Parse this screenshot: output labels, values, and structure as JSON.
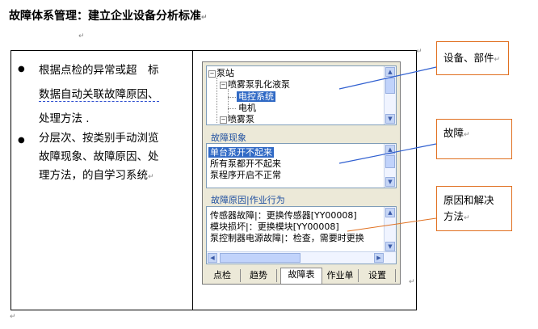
{
  "document": {
    "title": "故障体系管理：建立企业设备分析标准",
    "para_mark": "↵"
  },
  "left_column": {
    "bullets": [
      {
        "lines": [
          "根据点检的异常或超　标",
          "数据自动关联故障原因、",
          "处理方法 ."
        ]
      },
      {
        "lines": [
          "分层次、按类别手动浏览",
          "故障现象、故障原因、处",
          "理方法，的自学习系统"
        ]
      }
    ],
    "bullet_symbol": "●"
  },
  "app": {
    "tree": {
      "items": [
        {
          "label": "泵站",
          "expander": "−"
        },
        {
          "label": "喷雾泵乳化液泵",
          "expander": "−"
        },
        {
          "label": "电控系统",
          "selected": true
        },
        {
          "label": "电机"
        },
        {
          "label": "喷雾泵",
          "expander": "−"
        }
      ]
    },
    "symptoms": {
      "title": "故障现象",
      "items": [
        {
          "label": "单台泵开不起来",
          "selected": true
        },
        {
          "label": "所有泵都开不起来"
        },
        {
          "label": "泵程序开启不正常"
        }
      ]
    },
    "causes": {
      "title": "故障原因|作业行为",
      "items": [
        {
          "label": "传感器故障|：更换传感器[YY00008]"
        },
        {
          "label": "模块损坏|：更换模块[YY00008]"
        },
        {
          "label": "泵控制器电源故障|：检查，需要时更换"
        }
      ]
    },
    "tabs": [
      {
        "label": "点检"
      },
      {
        "label": "趋势"
      },
      {
        "label": "故障表",
        "active": true
      },
      {
        "label": "作业单"
      },
      {
        "label": "设置"
      }
    ]
  },
  "callouts": {
    "equipment": "设备、部件",
    "fault": "故障",
    "cause_line1": "原因和解决",
    "cause_line2": "方法"
  },
  "colors": {
    "selection": "#316ac5",
    "callout_border": "#e07020",
    "leader_line": "#2f5fd0",
    "panel_title": "#1e4fa0"
  }
}
